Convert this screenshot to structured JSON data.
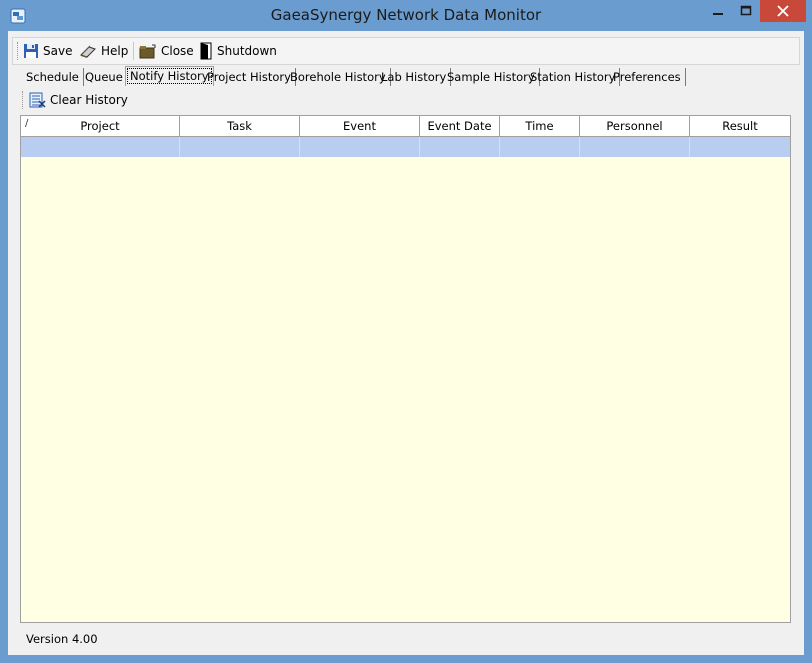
{
  "window": {
    "title": "GaeaSynergy Network Data Monitor",
    "controls": {
      "minimize": "minimize",
      "maximize": "maximize",
      "close": "close"
    },
    "accent": "#6b9ccf",
    "close_color": "#c8483a"
  },
  "toolbar": {
    "save_label": "Save",
    "help_label": "Help",
    "close_label": "Close",
    "shutdown_label": "Shutdown"
  },
  "tabs": [
    {
      "label": "Schedule",
      "active": false
    },
    {
      "label": "Queue",
      "active": false
    },
    {
      "label": "Notify History",
      "active": true
    },
    {
      "label": "Project History",
      "active": false
    },
    {
      "label": "Borehole History",
      "active": false
    },
    {
      "label": "Lab History",
      "active": false
    },
    {
      "label": "Sample History",
      "active": false
    },
    {
      "label": "Station History",
      "active": false
    },
    {
      "label": "Preferences",
      "active": false
    }
  ],
  "notify_history": {
    "clear_label": "Clear History",
    "sort_indicator": "/",
    "columns": [
      "Project",
      "Task",
      "Event",
      "Event Date",
      "Time",
      "Personnel",
      "Result"
    ],
    "rows": [
      [
        "",
        "",
        "",
        "",
        "",
        "",
        ""
      ]
    ],
    "grid_background": "#ffffe4",
    "selected_row_color": "#b8cdf0"
  },
  "status": {
    "version": "Version 4.00"
  }
}
